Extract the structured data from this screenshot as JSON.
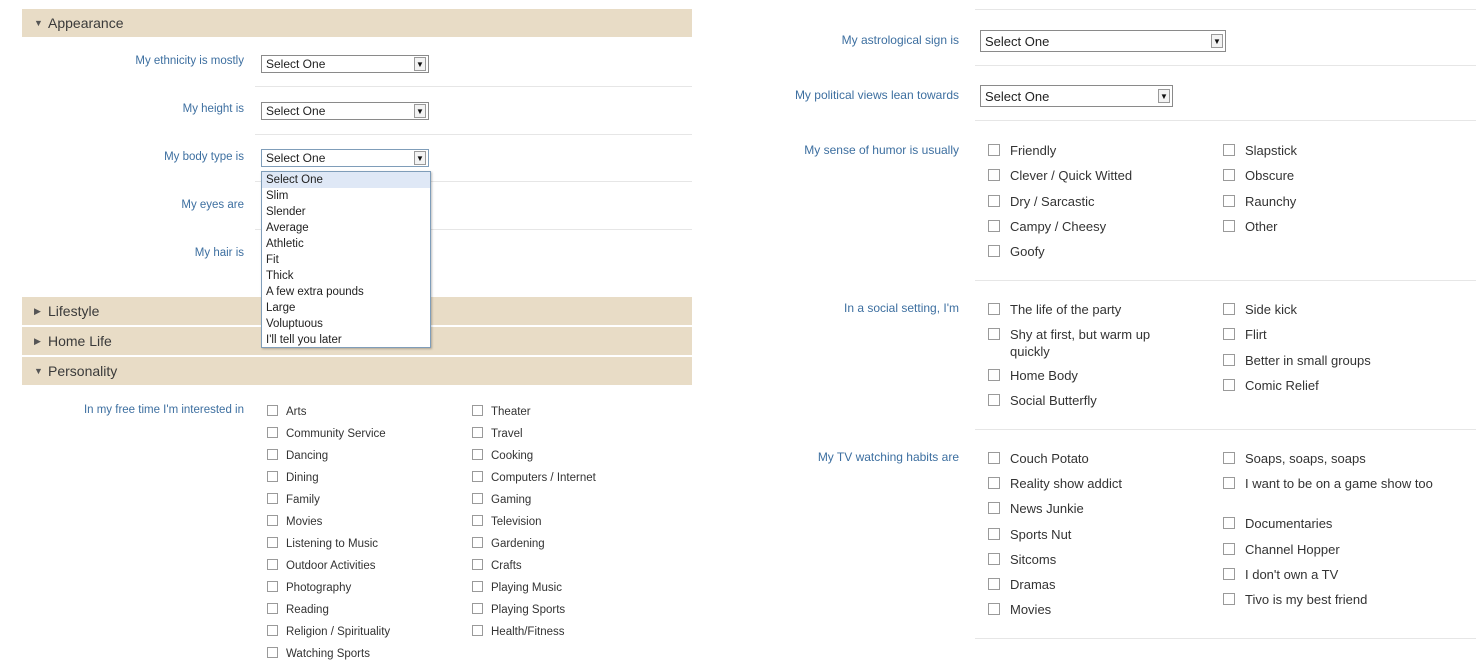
{
  "sections": {
    "appearance": "Appearance",
    "lifestyle": "Lifestyle",
    "home_life": "Home Life",
    "personality": "Personality"
  },
  "appearance": {
    "ethnicity": {
      "label": "My ethnicity is mostly",
      "value": "Select One"
    },
    "height": {
      "label": "My height is",
      "value": "Select One"
    },
    "body_type": {
      "label": "My body type is",
      "value": "Select One",
      "options": [
        "Select One",
        "Slim",
        "Slender",
        "Average",
        "Athletic",
        "Fit",
        "Thick",
        "A few extra pounds",
        "Large",
        "Voluptuous",
        "I'll tell you later"
      ]
    },
    "eyes": {
      "label": "My eyes are"
    },
    "hair": {
      "label": "My hair is"
    }
  },
  "interests": {
    "label": "In my free time I'm interested in",
    "col1": [
      "Arts",
      "Community Service",
      "Dancing",
      "Dining",
      "Family",
      "Movies",
      "Listening to Music",
      "Outdoor Activities",
      "Photography",
      "Reading",
      "Religion / Spirituality",
      "Watching Sports"
    ],
    "col2": [
      "Theater",
      "Travel",
      "Cooking",
      "Computers / Internet",
      "Gaming",
      "Television",
      "Gardening",
      "Crafts",
      "Playing Music",
      "Playing Sports",
      "Health/Fitness"
    ]
  },
  "right": {
    "astrological": {
      "label": "My astrological sign is",
      "value": "Select One"
    },
    "political": {
      "label": "My political views lean towards",
      "value": "Select One"
    },
    "humor": {
      "label": "My sense of humor is usually",
      "col1": [
        "Friendly",
        "Clever / Quick Witted",
        "Dry / Sarcastic",
        "Campy / Cheesy",
        "Goofy"
      ],
      "col2": [
        "Slapstick",
        "Obscure",
        "Raunchy",
        "Other"
      ]
    },
    "social": {
      "label": "In a social setting, I'm",
      "col1": [
        "The life of the party",
        "Shy at first, but warm up quickly",
        "Home Body",
        "Social Butterfly"
      ],
      "col2": [
        "Side kick",
        "Flirt",
        "Better in small groups",
        "Comic Relief"
      ]
    },
    "tv": {
      "label": "My TV watching habits are",
      "col1": [
        "Couch Potato",
        "Reality show addict",
        "News Junkie",
        "Sports Nut",
        "Sitcoms",
        "Dramas",
        "Movies"
      ],
      "col2": [
        "Soaps, soaps, soaps",
        "I want to be on a game show too",
        "Documentaries",
        "Channel Hopper",
        "I don't own a TV",
        "Tivo is my best friend"
      ]
    }
  }
}
